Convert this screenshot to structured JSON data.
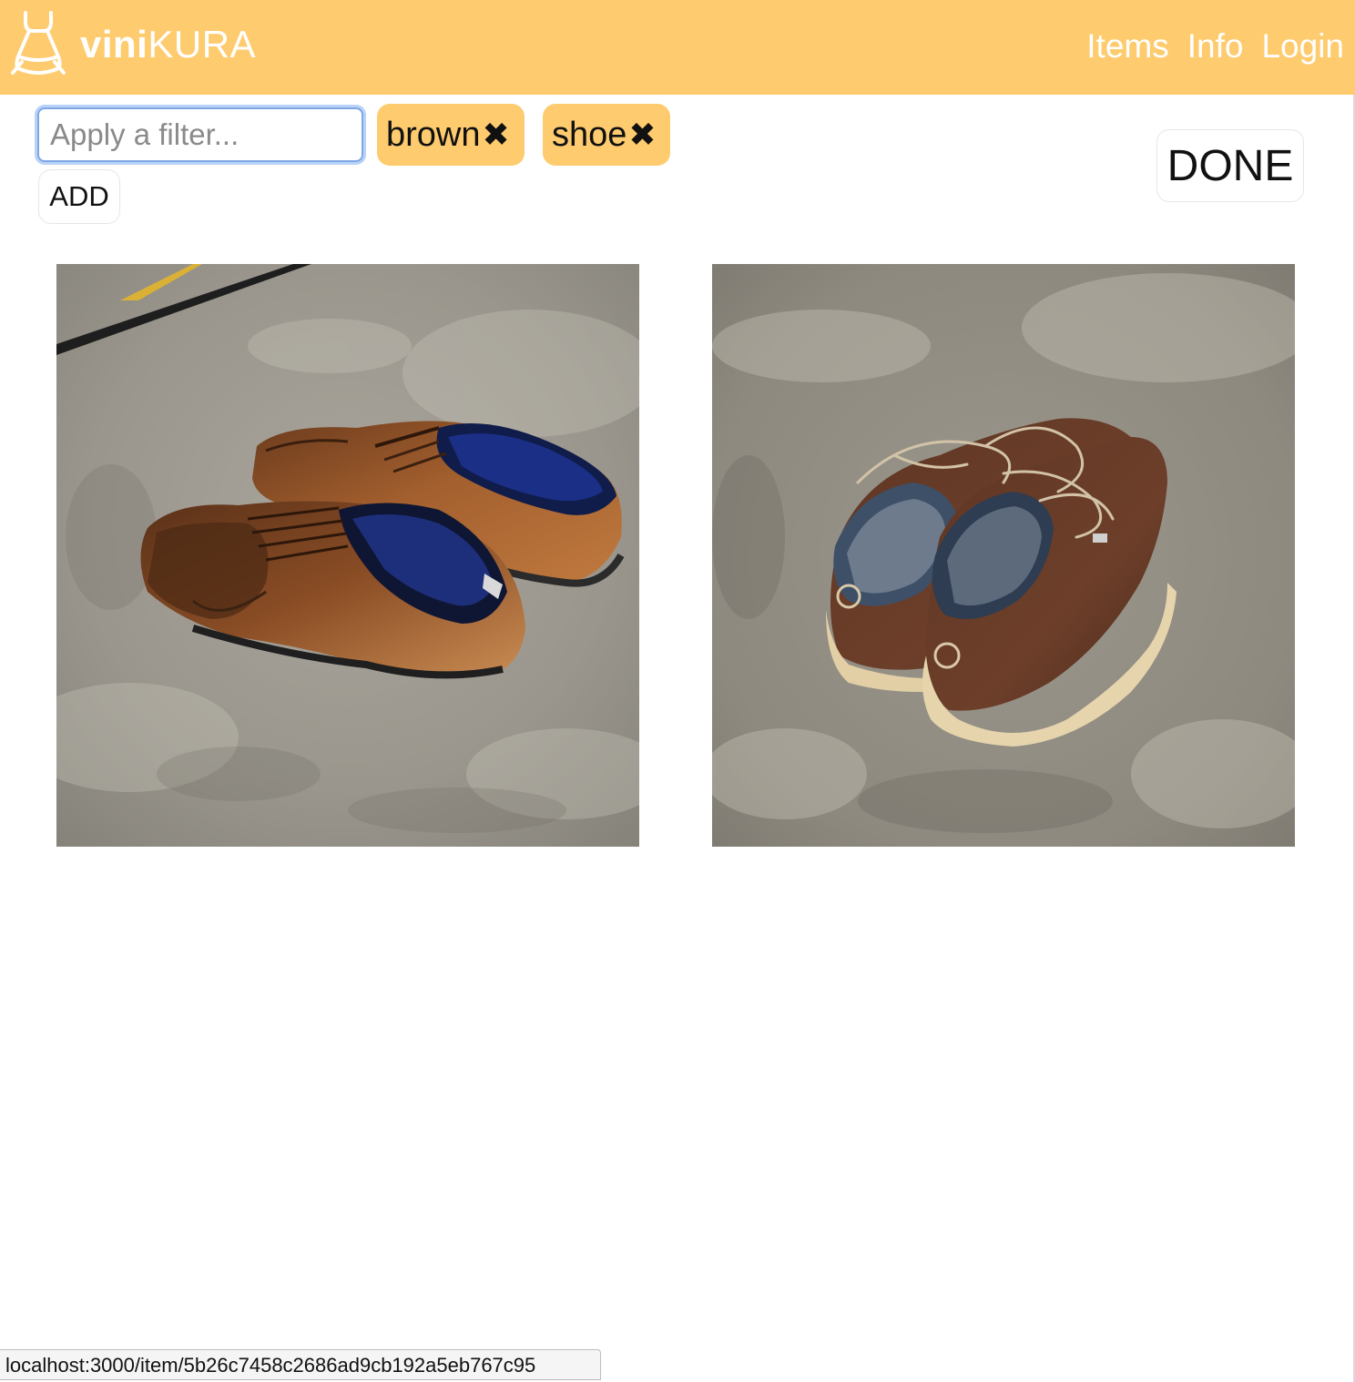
{
  "app": {
    "brand_bold": "vini",
    "brand_light": "KURA",
    "logo_icon": "dress-icon"
  },
  "nav": {
    "items": [
      "Items",
      "Info",
      "Login"
    ]
  },
  "filter": {
    "placeholder": "Apply a filter...",
    "value": "",
    "tags": [
      {
        "label": "brown",
        "remove_icon": "close-icon"
      },
      {
        "label": "shoe",
        "remove_icon": "close-icon"
      }
    ],
    "add_label": "ADD",
    "done_label": "DONE"
  },
  "items": [
    {
      "photo": "brown leather oxford dress shoes on concrete floor"
    },
    {
      "photo": "brown leather lace-up sneakers with cream soles on concrete floor"
    }
  ],
  "status_bar": {
    "url": "localhost:3000/item/5b26c7458c2686ad9cb192a5eb767c95"
  },
  "colors": {
    "navbar": "#fecb6e",
    "tag": "#fecb6e",
    "focus_ring": "#7fa7e6"
  }
}
